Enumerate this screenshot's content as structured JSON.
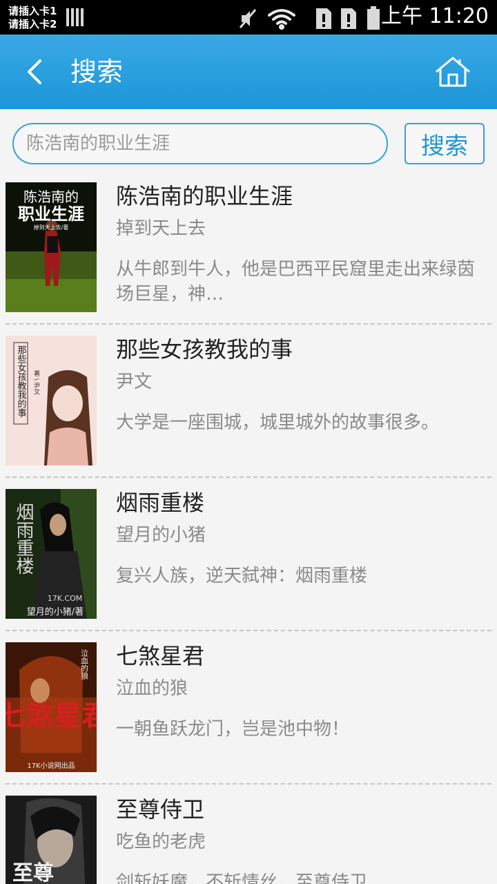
{
  "status_bar": {
    "sim1": "请插入卡1",
    "sim2": "请插入卡2",
    "time": "上午 11:20"
  },
  "header": {
    "title": "搜索",
    "back_icon": "chevron-left-icon",
    "home_icon": "home-icon"
  },
  "search": {
    "placeholder": "陈浩南的职业生涯",
    "value": "",
    "button_label": "搜索"
  },
  "colors": {
    "accent": "#1b96d8",
    "title_text": "#222222",
    "secondary_text": "#8a8a8a"
  },
  "results": [
    {
      "title": "陈浩南的职业生涯",
      "author": "掉到天上去",
      "description": "从牛郎到牛人，他是巴西平民窟里走出来绿茵场巨星，神…",
      "cover_text": [
        "陈浩南的",
        "职业生涯",
        "掉到天上去/著"
      ]
    },
    {
      "title": "那些女孩教我的事",
      "author": "尹文",
      "description": "大学是一座围城，城里城外的故事很多。",
      "cover_text": [
        "那些女孩教我的事",
        "著 \\ 尹文"
      ]
    },
    {
      "title": "烟雨重楼",
      "author": "望月的小猪",
      "description": "复兴人族，逆天弑神：烟雨重楼",
      "cover_text": [
        "烟雨重楼",
        "17K.COM",
        "望月的小猪/著"
      ]
    },
    {
      "title": "七煞星君",
      "author": "泣血的狼",
      "description": "一朝鱼跃龙门，岂是池中物！",
      "cover_text": [
        "七煞星君",
        "泣血的狼",
        "17K小说网出品"
      ]
    },
    {
      "title": "至尊侍卫",
      "author": "吃鱼的老虎",
      "description": "剑斩妖魔，不斩情丝，至尊侍卫",
      "cover_text": [
        "至尊"
      ]
    }
  ]
}
